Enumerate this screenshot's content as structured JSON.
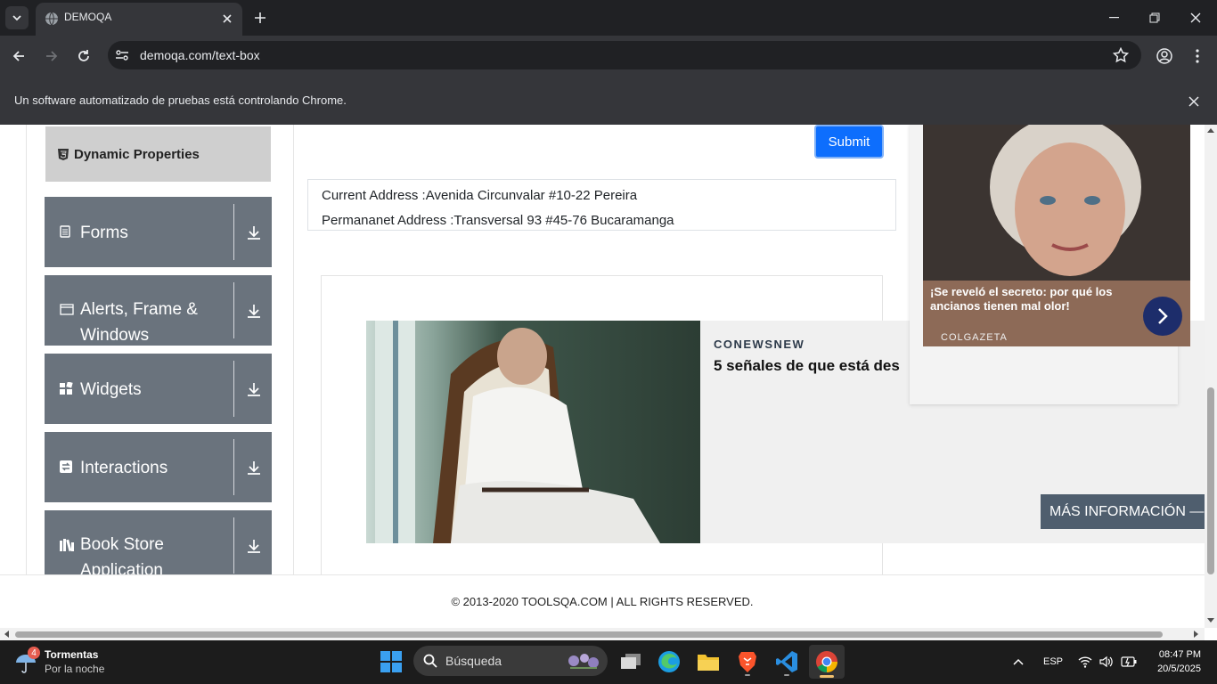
{
  "browser": {
    "tab_title": "DEMOQA",
    "url": "demoqa.com/text-box",
    "infobar_text": "Un software automatizado de pruebas está controlando Chrome."
  },
  "sidebar": {
    "dynamic_properties": "Dynamic Properties",
    "groups": [
      {
        "label": "Forms"
      },
      {
        "label": "Alerts, Frame & Windows"
      },
      {
        "label": "Widgets"
      },
      {
        "label": "Interactions"
      },
      {
        "label": "Book Store Application"
      }
    ]
  },
  "form": {
    "submit_label": "Submit",
    "current_address": "Current Address :Avenida Circunvalar #10-22 Pereira",
    "permanent_address": "Permananet Address :Transversal 93 #45-76 Bucaramanga"
  },
  "ads": {
    "ad1_brand": "CONEWSNEW",
    "ad1_headline": "5 señales de que está des",
    "ad1_button": "MÁS INFORMACIÓN —",
    "ad2_title": "¡Se reveló el secreto: por qué los ancianos tienen mal olor!",
    "ad2_brand": "COLGAZETA"
  },
  "footer": {
    "text": "© 2013-2020 TOOLSQA.COM | ALL RIGHTS RESERVED."
  },
  "taskbar": {
    "weather_badge": "4",
    "weather_title": "Tormentas",
    "weather_sub": "Por la noche",
    "search_placeholder": "Búsqueda",
    "language": "ESP",
    "time": "08:47 PM",
    "date": "20/5/2025"
  },
  "colors": {
    "accent": "#0d6efd",
    "sidebar_group": "#6a737d",
    "chrome_dark": "#202124",
    "chrome_toolbar": "#35363a"
  }
}
